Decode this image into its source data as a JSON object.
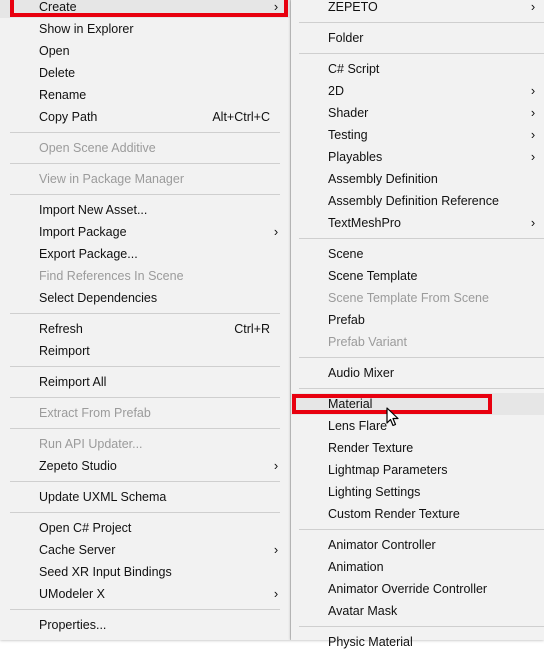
{
  "accent_color": "#e8000f",
  "main_menu": {
    "items": [
      {
        "label": "Create",
        "arrow": "›"
      },
      {
        "label": "Show in Explorer"
      },
      {
        "label": "Open"
      },
      {
        "label": "Delete"
      },
      {
        "label": "Rename"
      },
      {
        "label": "Copy Path",
        "shortcut": "Alt+Ctrl+C"
      },
      {
        "label": "Open Scene Additive",
        "disabled": true
      },
      {
        "label": "View in Package Manager",
        "disabled": true
      },
      {
        "label": "Import New Asset..."
      },
      {
        "label": "Import Package",
        "arrow": "›"
      },
      {
        "label": "Export Package..."
      },
      {
        "label": "Find References In Scene",
        "disabled": true
      },
      {
        "label": "Select Dependencies"
      },
      {
        "label": "Refresh",
        "shortcut": "Ctrl+R"
      },
      {
        "label": "Reimport"
      },
      {
        "label": "Reimport All"
      },
      {
        "label": "Extract From Prefab",
        "disabled": true
      },
      {
        "label": "Run API Updater...",
        "disabled": true
      },
      {
        "label": "Zepeto Studio",
        "arrow": "›"
      },
      {
        "label": "Update UXML Schema"
      },
      {
        "label": "Open C# Project"
      },
      {
        "label": "Cache Server",
        "arrow": "›"
      },
      {
        "label": "Seed XR Input Bindings"
      },
      {
        "label": "UModeler X",
        "arrow": "›"
      },
      {
        "label": "Properties..."
      }
    ]
  },
  "create_submenu": {
    "items": [
      {
        "label": "ZEPETO",
        "arrow": "›"
      },
      {
        "label": "Folder"
      },
      {
        "label": "C# Script"
      },
      {
        "label": "2D",
        "arrow": "›"
      },
      {
        "label": "Shader",
        "arrow": "›"
      },
      {
        "label": "Testing",
        "arrow": "›"
      },
      {
        "label": "Playables",
        "arrow": "›"
      },
      {
        "label": "Assembly Definition"
      },
      {
        "label": "Assembly Definition Reference"
      },
      {
        "label": "TextMeshPro",
        "arrow": "›"
      },
      {
        "label": "Scene"
      },
      {
        "label": "Scene Template"
      },
      {
        "label": "Scene Template From Scene",
        "disabled": true
      },
      {
        "label": "Prefab"
      },
      {
        "label": "Prefab Variant",
        "disabled": true
      },
      {
        "label": "Audio Mixer"
      },
      {
        "label": "Material",
        "hover": true
      },
      {
        "label": "Lens Flare"
      },
      {
        "label": "Render Texture"
      },
      {
        "label": "Lightmap Parameters"
      },
      {
        "label": "Lighting Settings"
      },
      {
        "label": "Custom Render Texture"
      },
      {
        "label": "Animator Controller"
      },
      {
        "label": "Animation"
      },
      {
        "label": "Animator Override Controller"
      },
      {
        "label": "Avatar Mask"
      },
      {
        "label": "Physic Material"
      }
    ]
  }
}
